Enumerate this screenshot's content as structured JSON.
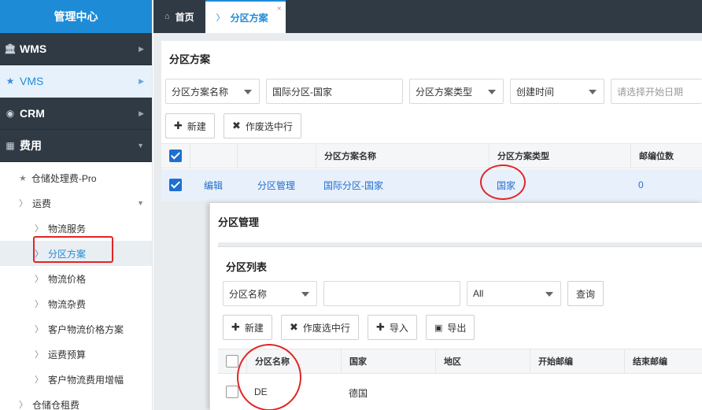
{
  "sidebar": {
    "brand": "管理中心",
    "menus": [
      {
        "label": "WMS",
        "icon": "bank-icon"
      },
      {
        "label": "VMS",
        "icon": "star-icon"
      },
      {
        "label": "CRM",
        "icon": "user-circle-icon"
      },
      {
        "label": "费用",
        "icon": "grid-icon"
      }
    ],
    "sub": {
      "storage_pro": "仓储处理费-Pro",
      "freight": "运费",
      "logistics_service": "物流服务",
      "zone_plan": "分区方案",
      "logistics_price": "物流价格",
      "logistics_misc": "物流杂费",
      "customer_price_plan": "客户物流价格方案",
      "freight_budget": "运费预算",
      "customer_fee_increase": "客户物流费用增幅",
      "warehouse_rent": "仓储仓租费"
    }
  },
  "tabs": {
    "home": "首页",
    "active": "分区方案",
    "close": "×"
  },
  "panel": {
    "title": "分区方案",
    "filters": {
      "field1": "分区方案名称",
      "value1": "国际分区-国家",
      "field2": "分区方案类型",
      "field3": "创建时间",
      "date_placeholder": "请选择开始日期"
    },
    "buttons": {
      "new": "新建",
      "void": "作废选中行"
    },
    "grid": {
      "headers": [
        "分区方案名称",
        "分区方案类型",
        "邮编位数"
      ],
      "row": {
        "edit": "编辑",
        "manage": "分区管理",
        "name": "国际分区-国家",
        "type": "国家",
        "digits": "0"
      }
    }
  },
  "dialog": {
    "title": "分区管理",
    "subtitle": "分区列表",
    "filters": {
      "field": "分区名称",
      "value": "",
      "select": "All",
      "query": "查询"
    },
    "buttons": {
      "new": "新建",
      "void": "作废选中行",
      "import": "导入",
      "export": "导出"
    },
    "grid": {
      "headers": [
        "分区名称",
        "国家",
        "地区",
        "开始邮编",
        "结束邮编"
      ],
      "row": {
        "name": "DE",
        "country": "德国"
      }
    }
  },
  "colors": {
    "accent": "#1e8bd6",
    "dark": "#2f3a44",
    "annotation": "#e12525"
  }
}
